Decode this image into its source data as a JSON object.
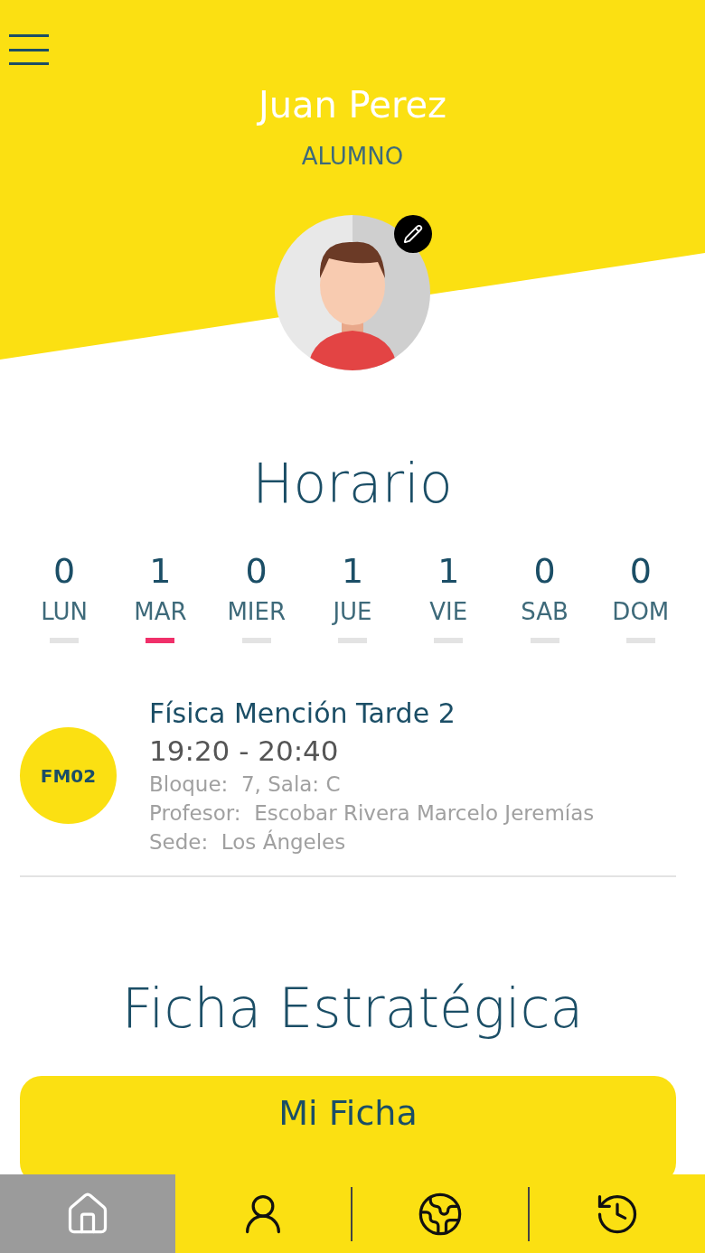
{
  "header": {
    "name": "Juan Perez",
    "role": "ALUMNO"
  },
  "schedule": {
    "title": "Horario",
    "days": [
      {
        "count": "0",
        "label": "LUN",
        "selected": false
      },
      {
        "count": "1",
        "label": "MAR",
        "selected": true
      },
      {
        "count": "0",
        "label": "MIER",
        "selected": false
      },
      {
        "count": "1",
        "label": "JUE",
        "selected": false
      },
      {
        "count": "1",
        "label": "VIE",
        "selected": false
      },
      {
        "count": "0",
        "label": "SAB",
        "selected": false
      },
      {
        "count": "0",
        "label": "DOM",
        "selected": false
      }
    ],
    "classes": [
      {
        "code": "FM02",
        "title": "Física Mención Tarde 2",
        "time": "19:20 - 20:40",
        "details": [
          "Bloque:  7, Sala: C",
          "Profesor:  Escobar Rivera Marcelo Jeremías",
          "Sede:  Los Ángeles"
        ]
      }
    ]
  },
  "strategic": {
    "title": "Ficha Estratégica",
    "card_title": "Mi Ficha"
  },
  "bottom_nav": [
    {
      "selected": true
    },
    {
      "selected": false
    },
    {
      "selected": false
    },
    {
      "selected": false
    }
  ]
}
